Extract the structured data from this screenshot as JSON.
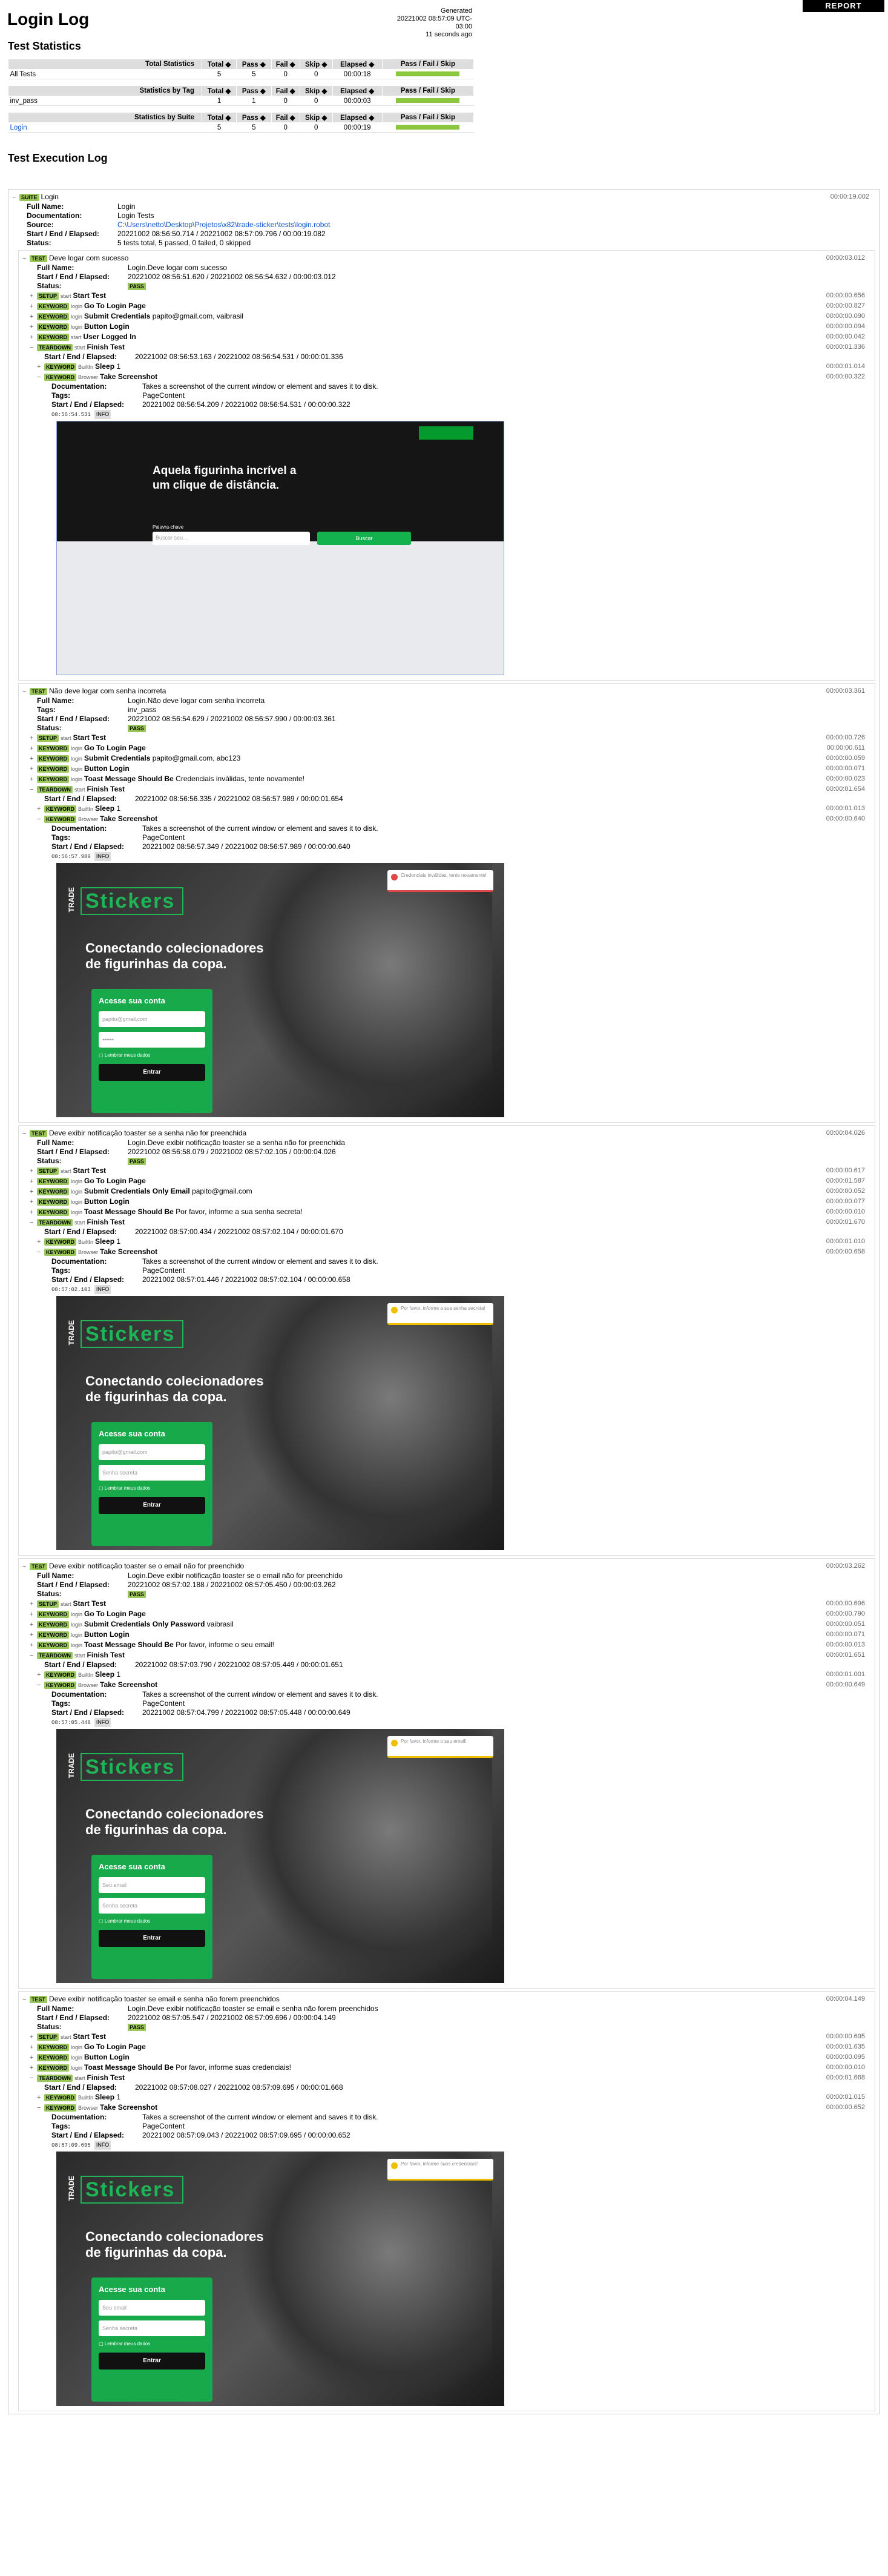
{
  "page": {
    "title": "Login Log",
    "generated_label": "Generated",
    "generated": "20221002 08:57:09 UTC-03:00",
    "ago": "11 seconds ago",
    "report_button": "REPORT"
  },
  "stats": {
    "heading": "Test Statistics",
    "cols": [
      "Total",
      "Pass",
      "Fail",
      "Skip",
      "Elapsed",
      "Pass / Fail / Skip"
    ],
    "total": {
      "label": "Total Statistics",
      "rows": [
        {
          "name": "All Tests",
          "total": "5",
          "pass": "5",
          "fail": "0",
          "skip": "0",
          "elapsed": "00:00:18"
        }
      ]
    },
    "tag": {
      "label": "Statistics by Tag",
      "rows": [
        {
          "name": "inv_pass",
          "total": "1",
          "pass": "1",
          "fail": "0",
          "skip": "0",
          "elapsed": "00:00:03"
        }
      ]
    },
    "suite": {
      "label": "Statistics by Suite",
      "rows": [
        {
          "name": "Login",
          "total": "5",
          "pass": "5",
          "fail": "0",
          "skip": "0",
          "elapsed": "00:00:19"
        }
      ]
    }
  },
  "log": {
    "heading": "Test Execution Log",
    "suite": {
      "label": "SUITE",
      "name": "Login",
      "elapsed": "00:00:19.002",
      "full_name_label": "Full Name:",
      "full_name": "Login",
      "doc_label": "Documentation:",
      "doc": "Login Tests",
      "source_label": "Source:",
      "source": "C:\\Users\\netto\\Desktop\\Projetos\\x82\\trade-sticker\\tests\\login.robot",
      "se_label": "Start / End / Elapsed:",
      "se": "20221002 08:56:50.714 / 20221002 08:57:09.796 / 00:00:19.082",
      "status_label": "Status:",
      "status": "5 tests total, 5 passed, 0 failed, 0 skipped"
    },
    "tests": [
      {
        "name": "Deve logar com sucesso",
        "elapsed": "00:00:03.012",
        "full_name": "Login.Deve logar com sucesso",
        "tags": "",
        "se": "20221002 08:56:51.620 / 20221002 08:56:54.632 / 00:00:03.012",
        "kws": [
          {
            "t": "SETUP",
            "lib": "start",
            "name": "Start Test",
            "args": "",
            "el": "00:00:00.656"
          },
          {
            "t": "KEYWORD",
            "lib": "login",
            "name": "Go To Login Page",
            "args": "",
            "el": "00:00:00.827"
          },
          {
            "t": "KEYWORD",
            "lib": "login",
            "name": "Submit Credentials",
            "args": "papito@gmail.com, vaibrasil",
            "el": "00:00:00.090"
          },
          {
            "t": "KEYWORD",
            "lib": "login",
            "name": "Button Login",
            "args": "",
            "el": "00:00:00.094"
          },
          {
            "t": "KEYWORD",
            "lib": "start",
            "name": "User Logged In",
            "args": "",
            "el": "00:00:00.042"
          }
        ],
        "td_el": "00:00:01.336",
        "td_se": "20221002 08:56:53.163 / 20221002 08:56:54.531 / 00:00:01.336",
        "sleep_el": "00:00:01.014",
        "shot_el": "00:00:00.322",
        "shot_se": "20221002 08:56:54.209 / 20221002 08:56:54.531 / 00:00:00.322",
        "ts": "08:56:54.531",
        "toast": ""
      },
      {
        "name": "Não deve logar com senha incorreta",
        "elapsed": "00:00:03.361",
        "full_name": "Login.Não deve logar com senha incorreta",
        "tags": "inv_pass",
        "se": "20221002 08:56:54.629 / 20221002 08:56:57.990 / 00:00:03.361",
        "kws": [
          {
            "t": "SETUP",
            "lib": "start",
            "name": "Start Test",
            "args": "",
            "el": "00:00:00.726"
          },
          {
            "t": "KEYWORD",
            "lib": "login",
            "name": "Go To Login Page",
            "args": "",
            "el": "00:00:00.611"
          },
          {
            "t": "KEYWORD",
            "lib": "login",
            "name": "Submit Credentials",
            "args": "papito@gmail.com, abc123",
            "el": "00:00:00.059"
          },
          {
            "t": "KEYWORD",
            "lib": "login",
            "name": "Button Login",
            "args": "",
            "el": "00:00:00.071"
          },
          {
            "t": "KEYWORD",
            "lib": "login",
            "name": "Toast Message Should Be",
            "args": "Credenciais inválidas, tente novamente!",
            "el": "00:00:00.023"
          }
        ],
        "td_el": "00:00:01.654",
        "td_se": "20221002 08:56:56.335 / 20221002 08:56:57.989 / 00:00:01.654",
        "sleep_el": "00:00:01.013",
        "shot_el": "00:00:00.640",
        "shot_se": "20221002 08:56:57.349 / 20221002 08:56:57.989 / 00:00:00.640",
        "ts": "08:56:57.989",
        "toast": "Credenciais inválidas, tente novamente!",
        "err": true
      },
      {
        "name": "Deve exibir notificação toaster se a senha não for preenchida",
        "elapsed": "00:00:04.026",
        "full_name": "Login.Deve exibir notificação toaster se a senha não for preenchida",
        "tags": "",
        "se": "20221002 08:56:58.079 / 20221002 08:57:02.105 / 00:00:04.026",
        "kws": [
          {
            "t": "SETUP",
            "lib": "start",
            "name": "Start Test",
            "args": "",
            "el": "00:00:00.617"
          },
          {
            "t": "KEYWORD",
            "lib": "login",
            "name": "Go To Login Page",
            "args": "",
            "el": "00:00:01.587"
          },
          {
            "t": "KEYWORD",
            "lib": "login",
            "name": "Submit Credentials Only Email",
            "args": "papito@gmail.com",
            "el": "00:00:00.052"
          },
          {
            "t": "KEYWORD",
            "lib": "login",
            "name": "Button Login",
            "args": "",
            "el": "00:00:00.077"
          },
          {
            "t": "KEYWORD",
            "lib": "login",
            "name": "Toast Message Should Be",
            "args": "Por favor, informe a sua senha secreta!",
            "el": "00:00:00.010"
          }
        ],
        "td_el": "00:00:01.670",
        "td_se": "20221002 08:57:00.434 / 20221002 08:57:02.104 / 00:00:01.670",
        "sleep_el": "00:00:01.010",
        "shot_el": "00:00:00.658",
        "shot_se": "20221002 08:57:01.446 / 20221002 08:57:02.104 / 00:00:00.658",
        "ts": "08:57:02.103",
        "toast": "Por favor, informe a sua senha secreta!"
      },
      {
        "name": "Deve exibir notificação toaster se o email não for preenchido",
        "elapsed": "00:00:03.262",
        "full_name": "Login.Deve exibir notificação toaster se o email não for preenchido",
        "tags": "",
        "se": "20221002 08:57:02.188 / 20221002 08:57:05.450 / 00:00:03.262",
        "kws": [
          {
            "t": "SETUP",
            "lib": "start",
            "name": "Start Test",
            "args": "",
            "el": "00:00:00.696"
          },
          {
            "t": "KEYWORD",
            "lib": "login",
            "name": "Go To Login Page",
            "args": "",
            "el": "00:00:00.790"
          },
          {
            "t": "KEYWORD",
            "lib": "login",
            "name": "Submit Credentials Only Password",
            "args": "vaibrasil",
            "el": "00:00:00.051"
          },
          {
            "t": "KEYWORD",
            "lib": "login",
            "name": "Button Login",
            "args": "",
            "el": "00:00:00.071"
          },
          {
            "t": "KEYWORD",
            "lib": "login",
            "name": "Toast Message Should Be",
            "args": "Por favor, informe o seu email!",
            "el": "00:00:00.013"
          }
        ],
        "td_el": "00:00:01.651",
        "td_se": "20221002 08:57:03.790 / 20221002 08:57:05.449 / 00:00:01.651",
        "sleep_el": "00:00:01.001",
        "shot_el": "00:00:00.649",
        "shot_se": "20221002 08:57:04.799 / 20221002 08:57:05.448 / 00:00:00.649",
        "ts": "08:57:05.448",
        "toast": "Por favor, informe o seu email!"
      },
      {
        "name": "Deve exibir notificação toaster se email e senha não forem preenchidos",
        "elapsed": "00:00:04.149",
        "full_name": "Login.Deve exibir notificação toaster se email e senha não forem preenchidos",
        "tags": "",
        "se": "20221002 08:57:05.547 / 20221002 08:57:09.696 / 00:00:04.149",
        "kws": [
          {
            "t": "SETUP",
            "lib": "start",
            "name": "Start Test",
            "args": "",
            "el": "00:00:00.695"
          },
          {
            "t": "KEYWORD",
            "lib": "login",
            "name": "Go To Login Page",
            "args": "",
            "el": "00:00:01.635"
          },
          {
            "t": "KEYWORD",
            "lib": "login",
            "name": "Button Login",
            "args": "",
            "el": "00:00:00.095"
          },
          {
            "t": "KEYWORD",
            "lib": "login",
            "name": "Toast Message Should Be",
            "args": "Por favor, informe suas credenciais!",
            "el": "00:00:00.010"
          }
        ],
        "td_el": "00:00:01.668",
        "td_se": "20221002 08:57:08.027 / 20221002 08:57:09.695 / 00:00:01.668",
        "sleep_el": "00:00:01.015",
        "shot_el": "00:00:00.652",
        "shot_se": "20221002 08:57:09.043 / 20221002 08:57:09.695 / 00:00:00.652",
        "ts": "08:57:09.695",
        "toast": "Por favor, informe suas credenciais!",
        "empty": true
      }
    ],
    "labels": {
      "test": "TEST",
      "full_name": "Full Name:",
      "tags": "Tags:",
      "se": "Start / End / Elapsed:",
      "status": "Status:",
      "pass": "PASS",
      "teardown": "TEARDOWN",
      "finish": "Finish Test",
      "sleep": "Sleep",
      "sleep_args": "1",
      "builtin": "BuiltIn",
      "browser": "Browser",
      "shot": "Take Screenshot",
      "doc_label": "Documentation:",
      "doc": "Takes a screenshot of the current window or element and saves it to disk.",
      "page_content": "PageContent",
      "info": "INFO",
      "start_lib": "start"
    },
    "app": {
      "home_title": "Aquela figurinha incrível a um clique de distância.",
      "search_label": "Palavra-chave",
      "search_ph": "Buscar seu...",
      "search_btn": "Buscar",
      "tagline": "Conectando colecionadores de figurinhas da copa.",
      "trade": "TRADE",
      "stickers": "Stickers",
      "card_title": "Acesse sua conta",
      "email_ph": "papito@gmail.com",
      "email_empty": "Seu email",
      "pass_ph": "Senha secreta",
      "remember": "Lembrar meus dados",
      "enter": "Entrar"
    }
  }
}
